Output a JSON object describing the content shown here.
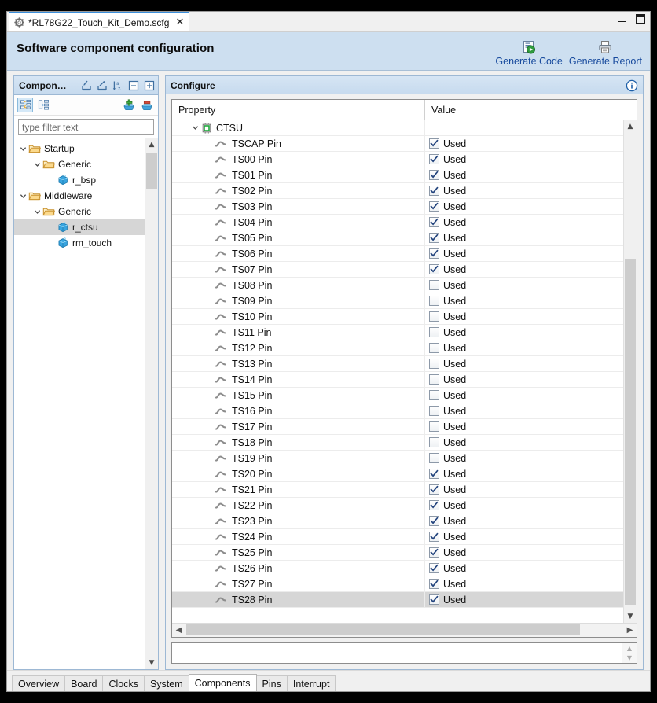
{
  "window": {
    "tab_title": "*RL78G22_Touch_Kit_Demo.scfg",
    "tab_icon": "gear-icon",
    "close_label": "✕",
    "minimize_label": "minimize",
    "maximize_label": "maximize"
  },
  "header": {
    "title": "Software component configuration",
    "actions": [
      {
        "label": "Generate Code",
        "icon": "generate-code-icon"
      },
      {
        "label": "Generate Report",
        "icon": "generate-report-icon"
      }
    ]
  },
  "sidebar": {
    "title": "Compon…",
    "header_icons": [
      "import-icon",
      "export-icon",
      "sort-az-icon",
      "collapse-all-icon",
      "expand-all-icon"
    ],
    "toolbar_icons": [
      "component-tree-view-icon",
      "hardware-tree-view-icon",
      "add-component-icon",
      "remove-component-icon"
    ],
    "filter": {
      "placeholder": "type filter text",
      "value": ""
    },
    "tree": [
      {
        "label": "Startup",
        "indent": 0,
        "icon": "folder-icon",
        "expanded": true,
        "selected": false
      },
      {
        "label": "Generic",
        "indent": 1,
        "icon": "folder-icon",
        "expanded": true,
        "selected": false
      },
      {
        "label": "r_bsp",
        "indent": 2,
        "icon": "component-icon",
        "expanded": null,
        "selected": false
      },
      {
        "label": "Middleware",
        "indent": 0,
        "icon": "folder-icon",
        "expanded": true,
        "selected": false
      },
      {
        "label": "Generic",
        "indent": 1,
        "icon": "folder-icon",
        "expanded": true,
        "selected": false
      },
      {
        "label": "r_ctsu",
        "indent": 2,
        "icon": "component-icon",
        "expanded": null,
        "selected": true
      },
      {
        "label": "rm_touch",
        "indent": 2,
        "icon": "component-icon",
        "expanded": null,
        "selected": false
      }
    ]
  },
  "configure": {
    "title": "Configure",
    "info_icon": "info-icon",
    "columns": [
      "Property",
      "Value"
    ],
    "group": {
      "label": "CTSU",
      "icon": "peripheral-icon",
      "expanded": true
    },
    "value_label": "Used",
    "rows": [
      {
        "name": "TSCAP Pin",
        "checked": true,
        "selected": false
      },
      {
        "name": "TS00 Pin",
        "checked": true,
        "selected": false
      },
      {
        "name": "TS01 Pin",
        "checked": true,
        "selected": false
      },
      {
        "name": "TS02 Pin",
        "checked": true,
        "selected": false
      },
      {
        "name": "TS03 Pin",
        "checked": true,
        "selected": false
      },
      {
        "name": "TS04 Pin",
        "checked": true,
        "selected": false
      },
      {
        "name": "TS05 Pin",
        "checked": true,
        "selected": false
      },
      {
        "name": "TS06 Pin",
        "checked": true,
        "selected": false
      },
      {
        "name": "TS07 Pin",
        "checked": true,
        "selected": false
      },
      {
        "name": "TS08 Pin",
        "checked": false,
        "selected": false
      },
      {
        "name": "TS09 Pin",
        "checked": false,
        "selected": false
      },
      {
        "name": "TS10 Pin",
        "checked": false,
        "selected": false
      },
      {
        "name": "TS11 Pin",
        "checked": false,
        "selected": false
      },
      {
        "name": "TS12 Pin",
        "checked": false,
        "selected": false
      },
      {
        "name": "TS13 Pin",
        "checked": false,
        "selected": false
      },
      {
        "name": "TS14 Pin",
        "checked": false,
        "selected": false
      },
      {
        "name": "TS15 Pin",
        "checked": false,
        "selected": false
      },
      {
        "name": "TS16 Pin",
        "checked": false,
        "selected": false
      },
      {
        "name": "TS17 Pin",
        "checked": false,
        "selected": false
      },
      {
        "name": "TS18 Pin",
        "checked": false,
        "selected": false
      },
      {
        "name": "TS19 Pin",
        "checked": false,
        "selected": false
      },
      {
        "name": "TS20 Pin",
        "checked": true,
        "selected": false
      },
      {
        "name": "TS21 Pin",
        "checked": true,
        "selected": false
      },
      {
        "name": "TS22 Pin",
        "checked": true,
        "selected": false
      },
      {
        "name": "TS23 Pin",
        "checked": true,
        "selected": false
      },
      {
        "name": "TS24 Pin",
        "checked": true,
        "selected": false
      },
      {
        "name": "TS25 Pin",
        "checked": true,
        "selected": false
      },
      {
        "name": "TS26 Pin",
        "checked": true,
        "selected": false
      },
      {
        "name": "TS27 Pin",
        "checked": true,
        "selected": false
      },
      {
        "name": "TS28 Pin",
        "checked": true,
        "selected": true
      }
    ],
    "detail_field": {
      "value": ""
    }
  },
  "bottom_tabs": [
    {
      "label": "Overview",
      "active": false
    },
    {
      "label": "Board",
      "active": false
    },
    {
      "label": "Clocks",
      "active": false
    },
    {
      "label": "System",
      "active": false
    },
    {
      "label": "Components",
      "active": true
    },
    {
      "label": "Pins",
      "active": false
    },
    {
      "label": "Interrupt",
      "active": false
    }
  ],
  "colors": {
    "header_band": "#cddff0",
    "link": "#15489c",
    "selection": "#d6d6d6",
    "accent_tab": "#3a8edb"
  }
}
